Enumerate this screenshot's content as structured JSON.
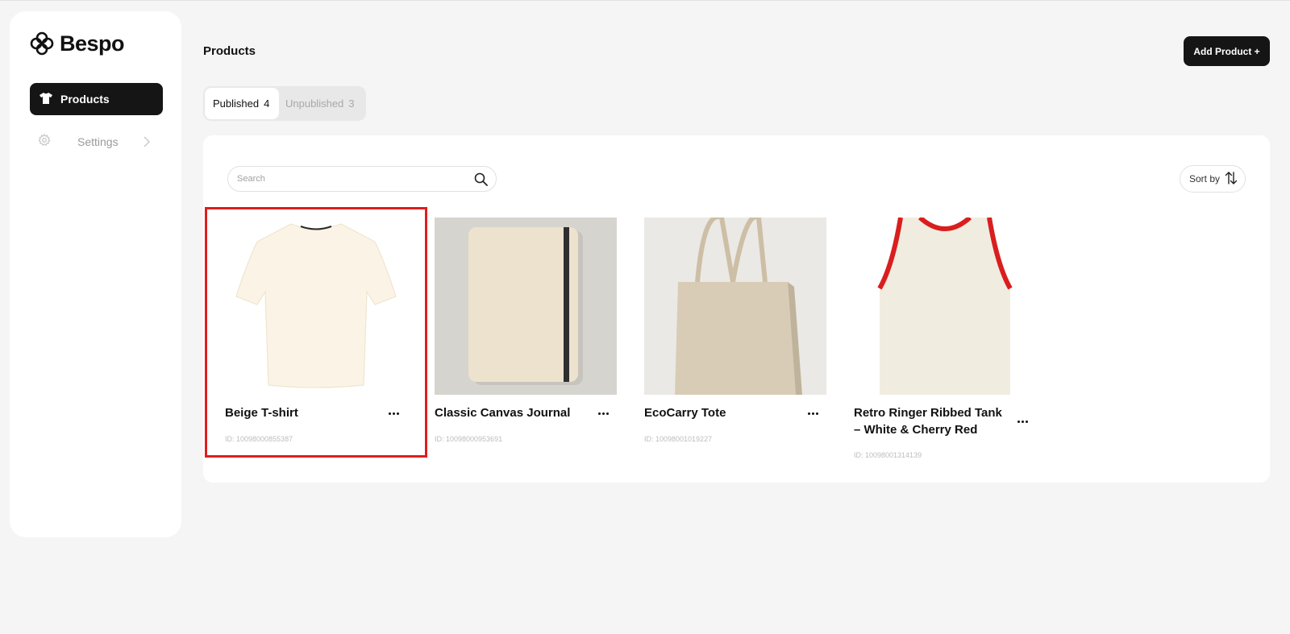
{
  "app": {
    "name": "Bespo"
  },
  "sidebar": {
    "items": [
      {
        "label": "Products",
        "icon": "tshirt-icon",
        "active": true
      },
      {
        "label": "Settings",
        "icon": "gear-icon",
        "active": false
      }
    ]
  },
  "header": {
    "title": "Products",
    "add_button_label": "Add Product +"
  },
  "tabs": [
    {
      "label": "Published",
      "count": "4",
      "active": true
    },
    {
      "label": "Unpublished",
      "count": "3",
      "active": false
    }
  ],
  "search": {
    "placeholder": "Search",
    "value": ""
  },
  "sort": {
    "label": "Sort by"
  },
  "products": [
    {
      "name": "Beige T-shirt",
      "id": "ID: 10098000855387",
      "image": "beige-tshirt"
    },
    {
      "name": "Classic Canvas Journal",
      "id": "ID: 10098000953691",
      "image": "canvas-journal"
    },
    {
      "name": "EcoCarry Tote",
      "id": "ID: 10098001019227",
      "image": "canvas-tote"
    },
    {
      "name": "Retro Ringer Ribbed Tank – White & Cherry Red",
      "id": "ID: 10098001314139",
      "image": "ringer-tank"
    }
  ],
  "colors": {
    "primary": "#151515",
    "highlight": "#e01d1d",
    "background": "#f5f5f5"
  }
}
